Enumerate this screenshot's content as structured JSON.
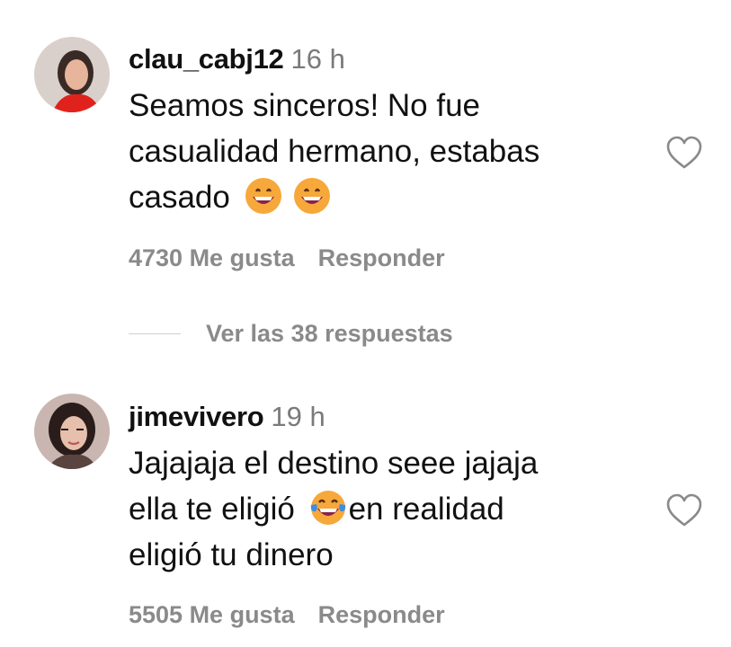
{
  "comments": [
    {
      "username": "clau_cabj12",
      "time": "16 h",
      "text_lines": [
        "Seamos sinceros! No fue",
        "casualidad hermano, estabas",
        "casado"
      ],
      "emoji_names": [
        "grinning-face-emoji",
        "grinning-face-emoji"
      ],
      "likes": "4730 Me gusta",
      "reply": "Responder",
      "icon": "heart-outline-icon"
    },
    {
      "username": "jimevivero",
      "time": "19 h",
      "text_lines": [
        "Jajajaja el destino seee jajaja",
        "ella te eligió",
        "en realidad",
        "eligió tu dinero"
      ],
      "emoji_names": [
        "tears-of-joy-emoji"
      ],
      "likes": "5505 Me gusta",
      "reply": "Responder",
      "icon": "heart-outline-icon"
    }
  ],
  "view_replies": "Ver las 38 respuestas",
  "colors": {
    "text": "#111111",
    "muted": "#8a8a8a",
    "emoji": "#f7a83a"
  }
}
